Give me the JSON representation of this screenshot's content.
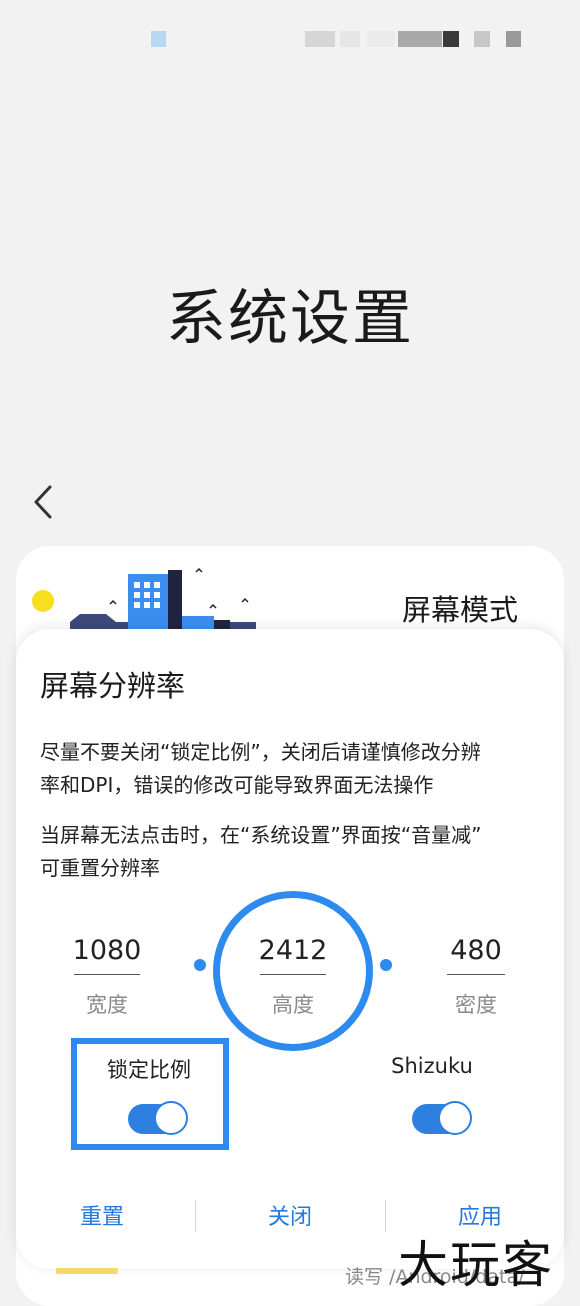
{
  "page": {
    "title": "系统设置"
  },
  "nav": {
    "back_icon": "chevron-left-icon"
  },
  "card": {
    "title": "屏幕模式"
  },
  "dialog": {
    "title": "屏幕分辨率",
    "desc1": [
      "尽量不要关闭“锁定比例”，关闭后请谨慎修改分辨",
      "率和DPI，错误的修改可能导致界面无法操作"
    ],
    "desc2": [
      "当屏幕无法点击时，在“系统设置”界面按“音量减”",
      "可重置分辨率"
    ],
    "fields": [
      {
        "value": "1080",
        "label": "宽度"
      },
      {
        "value": "2412",
        "label": "高度"
      },
      {
        "value": "480",
        "label": "密度"
      }
    ],
    "toggles": [
      {
        "label": "锁定比例",
        "on": true
      },
      {
        "label": "Shizuku",
        "on": true
      }
    ],
    "buttons": {
      "reset": "重置",
      "close": "关闭",
      "apply": "应用"
    }
  },
  "footer": {
    "text": "读写 /Android/data/"
  },
  "watermark": "大玩客",
  "colors": {
    "accent": "#2d8bef",
    "button_text": "#2478de",
    "sun": "#f7df20"
  }
}
